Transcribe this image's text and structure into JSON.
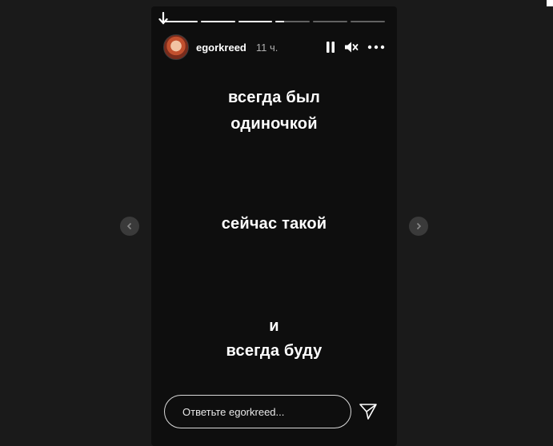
{
  "story": {
    "username": "egorkreed",
    "time": "11 ч.",
    "progress": [
      1,
      1,
      1,
      0.25,
      0,
      0
    ],
    "lines": [
      {
        "text": "всегда был"
      },
      {
        "text": "одиночкой"
      },
      {
        "text": "сейчас такой"
      },
      {
        "text": "и"
      },
      {
        "text": "всегда буду"
      }
    ],
    "reply_placeholder": "Ответьте egorkreed..."
  },
  "icons": [
    "pause-icon",
    "muted-speaker-icon",
    "more-icon",
    "send-icon",
    "chevron-left-icon",
    "chevron-right-icon"
  ]
}
